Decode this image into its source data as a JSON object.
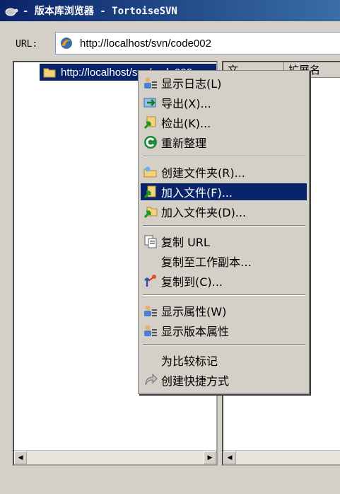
{
  "window": {
    "title": "- 版本库浏览器 - TortoiseSVN"
  },
  "url_bar": {
    "label": "URL:",
    "value": "http://localhost/svn/code002"
  },
  "tree": {
    "selected_item": "http://localhost/svn/code002"
  },
  "list": {
    "columns": [
      "文",
      "扩展名"
    ]
  },
  "context_menu": {
    "items": [
      {
        "label": "显示日志(L)",
        "icon": "show-log-icon"
      },
      {
        "label": "导出(X)...",
        "icon": "export-icon"
      },
      {
        "label": "检出(K)...",
        "icon": "checkout-icon"
      },
      {
        "label": "重新整理",
        "icon": "refresh-icon"
      },
      {
        "label": "创建文件夹(R)...",
        "icon": "create-folder-icon"
      },
      {
        "label": "加入文件(F)...",
        "icon": "add-file-icon",
        "selected": true
      },
      {
        "label": "加入文件夹(D)...",
        "icon": "add-folder-icon"
      },
      {
        "label": "复制 URL",
        "icon": "copy-url-icon"
      },
      {
        "label": "复制至工作副本…",
        "icon": ""
      },
      {
        "label": "复制到(C)...",
        "icon": "copy-to-icon"
      },
      {
        "label": "显示属性(W)",
        "icon": "properties-icon"
      },
      {
        "label": "显示版本属性",
        "icon": "revision-properties-icon"
      },
      {
        "label": "为比较标记",
        "icon": ""
      },
      {
        "label": "创建快捷方式",
        "icon": "shortcut-icon"
      }
    ]
  },
  "colors": {
    "titlebar_start": "#0a246a",
    "titlebar_end": "#3a6ea5",
    "selection": "#0a246a",
    "face": "#d4d0c8"
  }
}
